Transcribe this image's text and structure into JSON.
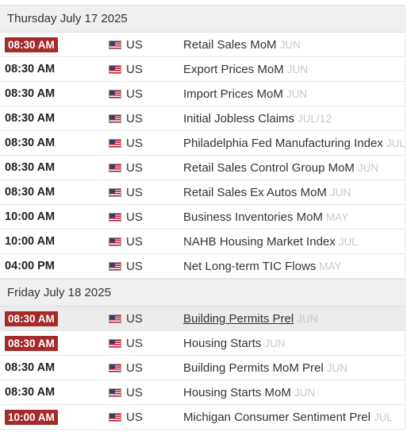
{
  "days": [
    {
      "title": "Thursday July 17 2025",
      "events": [
        {
          "time": "08:30 AM",
          "badge": true,
          "country": "US",
          "name": "Retail Sales MoM",
          "period": "JUN"
        },
        {
          "time": "08:30 AM",
          "badge": false,
          "country": "US",
          "name": "Export Prices MoM",
          "period": "JUN"
        },
        {
          "time": "08:30 AM",
          "badge": false,
          "country": "US",
          "name": "Import Prices MoM",
          "period": "JUN"
        },
        {
          "time": "08:30 AM",
          "badge": false,
          "country": "US",
          "name": "Initial Jobless Claims",
          "period": "JUL/12"
        },
        {
          "time": "08:30 AM",
          "badge": false,
          "country": "US",
          "name": "Philadelphia Fed Manufacturing Index",
          "period": "JUL"
        },
        {
          "time": "08:30 AM",
          "badge": false,
          "country": "US",
          "name": "Retail Sales Control Group MoM",
          "period": "JUN"
        },
        {
          "time": "08:30 AM",
          "badge": false,
          "country": "US",
          "name": "Retail Sales Ex Autos MoM",
          "period": "JUN"
        },
        {
          "time": "10:00 AM",
          "badge": false,
          "country": "US",
          "name": "Business Inventories MoM",
          "period": "MAY"
        },
        {
          "time": "10:00 AM",
          "badge": false,
          "country": "US",
          "name": "NAHB Housing Market Index",
          "period": "JUL"
        },
        {
          "time": "04:00 PM",
          "badge": false,
          "country": "US",
          "name": "Net Long-term TIC Flows",
          "period": "MAY"
        }
      ]
    },
    {
      "title": "Friday July 18 2025",
      "events": [
        {
          "time": "08:30 AM",
          "badge": true,
          "country": "US",
          "name": "Building Permits Prel",
          "period": "JUN",
          "highlight": true
        },
        {
          "time": "08:30 AM",
          "badge": true,
          "country": "US",
          "name": "Housing Starts",
          "period": "JUN"
        },
        {
          "time": "08:30 AM",
          "badge": false,
          "country": "US",
          "name": "Building Permits MoM Prel",
          "period": "JUN"
        },
        {
          "time": "08:30 AM",
          "badge": false,
          "country": "US",
          "name": "Housing Starts MoM",
          "period": "JUN"
        },
        {
          "time": "10:00 AM",
          "badge": true,
          "country": "US",
          "name": "Michigan Consumer Sentiment Prel",
          "period": "JUL"
        }
      ]
    }
  ],
  "colors": {
    "badge": "#a52a2a",
    "period": "#c8c8c8",
    "header_bg": "#f0f0f0"
  },
  "icons": {
    "flag": "us-flag-icon"
  }
}
